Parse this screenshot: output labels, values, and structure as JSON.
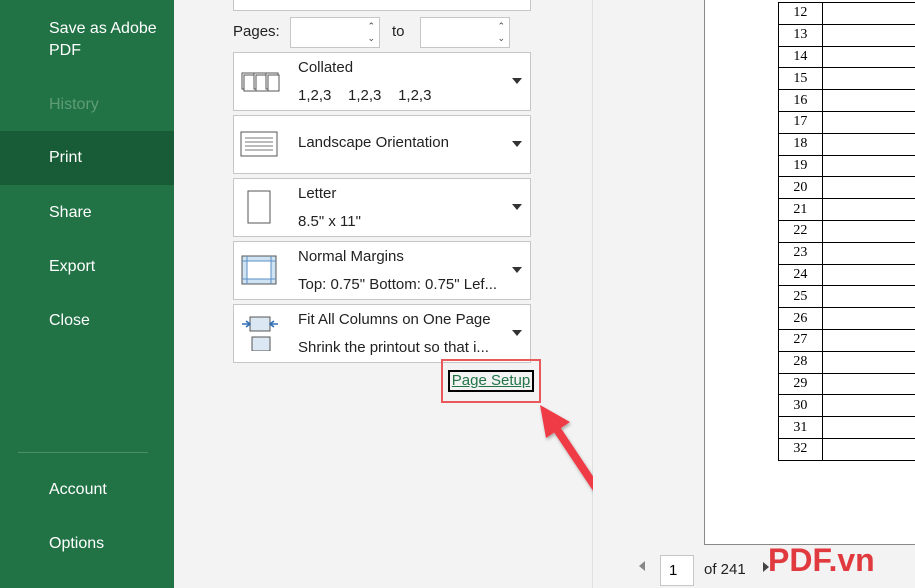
{
  "sidebar": {
    "items": [
      {
        "label": "Save as Adobe PDF",
        "state": "normal"
      },
      {
        "label": "History",
        "state": "disabled"
      },
      {
        "label": "Print",
        "state": "active"
      },
      {
        "label": "Share",
        "state": "normal"
      },
      {
        "label": "Export",
        "state": "normal"
      },
      {
        "label": "Close",
        "state": "normal"
      },
      {
        "label": "Account",
        "state": "normal"
      },
      {
        "label": "Options",
        "state": "normal"
      }
    ],
    "colors": {
      "background": "#217346",
      "active": "#185c37"
    }
  },
  "settings": {
    "pages_label": "Pages:",
    "pages_from": "",
    "to_label": "to",
    "pages_to": "",
    "collation": {
      "title": "Collated",
      "detail": "1,2,3    1,2,3    1,2,3",
      "icon": "collated-icon"
    },
    "orientation": {
      "title": "Landscape Orientation",
      "icon": "landscape-icon"
    },
    "paper": {
      "title": "Letter",
      "detail": "8.5\" x 11\"",
      "icon": "paper-icon"
    },
    "margins": {
      "title": "Normal Margins",
      "detail": "Top: 0.75\" Bottom: 0.75\" Lef...",
      "icon": "margins-icon"
    },
    "scaling": {
      "title": "Fit All Columns on One Page",
      "detail": "Shrink the printout so that i...",
      "icon": "fit-columns-icon"
    },
    "page_setup_link": "Page Setup",
    "highlight_color": "#e8595b"
  },
  "preview": {
    "row_numbers": [
      "12",
      "13",
      "14",
      "15",
      "16",
      "17",
      "18",
      "19",
      "20",
      "21",
      "22",
      "23",
      "24",
      "25",
      "26",
      "27",
      "28",
      "29",
      "30",
      "31",
      "32"
    ],
    "current_page": "1",
    "of_pages": "of 241"
  },
  "watermark": "PDF.vn"
}
